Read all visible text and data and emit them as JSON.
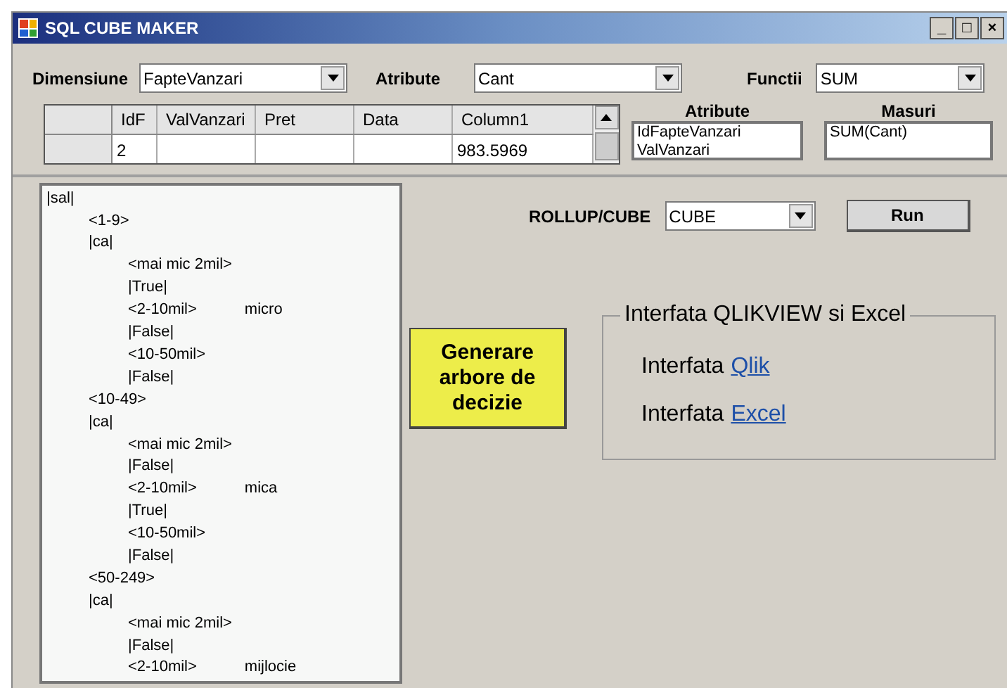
{
  "window": {
    "title": "SQL CUBE MAKER",
    "controls": [
      "_",
      "□",
      "×"
    ]
  },
  "filters": [
    {
      "label": "Dimensiune",
      "value": "FapteVanzari"
    },
    {
      "label": "Atribute",
      "value": "Cant"
    },
    {
      "label": "Functii",
      "value": "SUM"
    }
  ],
  "grid": {
    "columns": [
      "IdF",
      "ValVanzari",
      "Pret",
      "Data",
      "Column1"
    ],
    "rows": [
      [
        "2",
        "",
        "",
        "",
        "983.5969"
      ]
    ]
  },
  "atribute_list": {
    "title": "Atribute",
    "items": [
      "IdFapteVanzari",
      "ValVanzari"
    ]
  },
  "masuri_list": {
    "title": "Masuri",
    "items": [
      "SUM(Cant)"
    ]
  },
  "tree": [
    {
      "text": "|sal|",
      "children": [
        {
          "text": "<1-9>"
        },
        {
          "text": "|ca|",
          "children": [
            {
              "text": "<mai mic 2mil>"
            },
            {
              "text": "|True|"
            },
            {
              "text": "<2-10mil>",
              "result": "micro"
            },
            {
              "text": "|False|"
            },
            {
              "text": "<10-50mil>"
            },
            {
              "text": "|False|"
            }
          ]
        },
        {
          "text": "<10-49>"
        },
        {
          "text": "|ca|",
          "children": [
            {
              "text": "<mai mic 2mil>"
            },
            {
              "text": "|False|"
            },
            {
              "text": "<2-10mil>",
              "result": "mica"
            },
            {
              "text": "|True|"
            },
            {
              "text": "<10-50mil>"
            },
            {
              "text": "|False|"
            }
          ]
        },
        {
          "text": "<50-249>"
        },
        {
          "text": "|ca|",
          "children": [
            {
              "text": "<mai mic 2mil>"
            },
            {
              "text": "|False|"
            },
            {
              "text": "<2-10mil>",
              "result": "mijlocie"
            }
          ]
        }
      ]
    }
  ],
  "rollup": {
    "label": "ROLLUP/CUBE",
    "value": "CUBE"
  },
  "run_button": "Run",
  "decision_button": "Generare arbore de decizie",
  "interface_group": {
    "title": "Interfata QLIKVIEW si Excel",
    "links": [
      {
        "prefix": "Interfata",
        "link": "Qlik"
      },
      {
        "prefix": "Interfata",
        "link": "Excel"
      }
    ]
  }
}
